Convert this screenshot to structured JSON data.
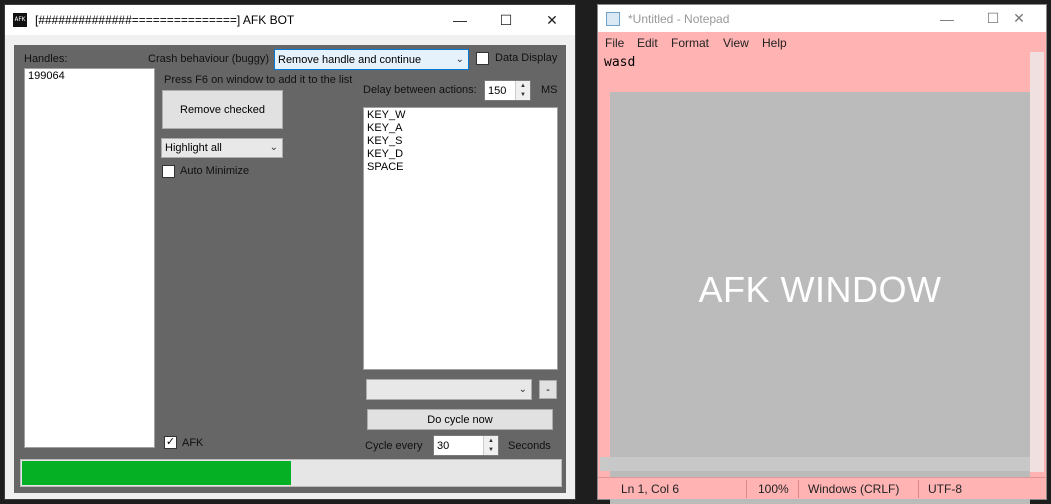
{
  "afk_bot": {
    "icon_text": "AFK",
    "title": "[##############===============] AFK BOT",
    "minimize_glyph": "—",
    "maximize_glyph": "☐",
    "close_glyph": "✕",
    "handles_label": "Handles:",
    "handles": [
      "199064"
    ],
    "crash_label": "Crash behaviour (buggy)",
    "crash_value": "Remove handle and continue",
    "data_display_label": "Data Display",
    "data_display_checked": false,
    "press_f6_text": "Press F6 on window to add it to the list",
    "remove_checked_label": "Remove checked",
    "highlight_value": "Highlight all",
    "auto_minimize_label": "Auto Minimize",
    "auto_minimize_checked": false,
    "delay_label": "Delay between actions:",
    "delay_value": "150",
    "delay_unit": "MS",
    "actions": [
      "KEY_W",
      "KEY_A",
      "KEY_S",
      "KEY_D",
      "SPACE"
    ],
    "action_select_value": "",
    "remove_action_label": "-",
    "do_cycle_label": "Do cycle now",
    "afk_label": "AFK",
    "afk_checked": true,
    "cycle_label": "Cycle every",
    "cycle_value": "30",
    "cycle_unit": "Seconds",
    "progress_fraction": 0.5
  },
  "notepad": {
    "title": "*Untitled - Notepad",
    "minimize_glyph": "—",
    "maximize_glyph": "☐",
    "close_glyph": "✕",
    "menu": [
      "File",
      "Edit",
      "Format",
      "View",
      "Help"
    ],
    "content": "wasd",
    "overlay_text": "AFK WINDOW",
    "status": {
      "position": "Ln 1, Col 6",
      "zoom": "100%",
      "line_ending": "Windows (CRLF)",
      "encoding": "UTF-8"
    }
  },
  "colors": {
    "progress_fill": "#06b025",
    "notepad_tint": "#ffb3b3",
    "overlay_gray": "#bbbbbb",
    "bot_client": "#666666"
  }
}
